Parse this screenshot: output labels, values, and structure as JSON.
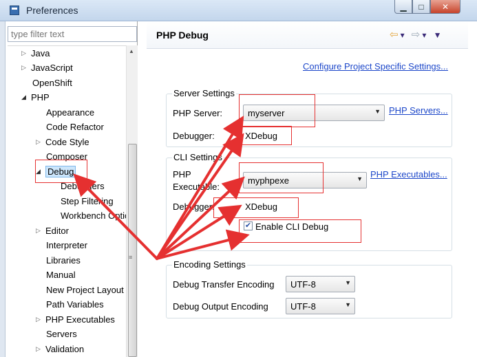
{
  "window": {
    "title": "Preferences"
  },
  "sidebar": {
    "filter_placeholder": "type filter text",
    "items": [
      {
        "label": "Java",
        "arrow": "▷"
      },
      {
        "label": "JavaScript",
        "arrow": "▷"
      },
      {
        "label": "OpenShift",
        "arrow": ""
      },
      {
        "label": "PHP",
        "arrow": "◢"
      },
      {
        "label": "Appearance",
        "arrow": ""
      },
      {
        "label": "Code Refactor",
        "arrow": ""
      },
      {
        "label": "Code Style",
        "arrow": "▷"
      },
      {
        "label": "Composer",
        "arrow": ""
      },
      {
        "label": "Debug",
        "arrow": "◢"
      },
      {
        "label": "Debuggers",
        "arrow": ""
      },
      {
        "label": "Step Filtering",
        "arrow": ""
      },
      {
        "label": "Workbench Options",
        "arrow": ""
      },
      {
        "label": "Editor",
        "arrow": "▷"
      },
      {
        "label": "Interpreter",
        "arrow": ""
      },
      {
        "label": "Libraries",
        "arrow": ""
      },
      {
        "label": "Manual",
        "arrow": ""
      },
      {
        "label": "New Project Layout",
        "arrow": ""
      },
      {
        "label": "Path Variables",
        "arrow": ""
      },
      {
        "label": "PHP Executables",
        "arrow": "▷"
      },
      {
        "label": "Servers",
        "arrow": ""
      },
      {
        "label": "Validation",
        "arrow": "▷"
      }
    ]
  },
  "page": {
    "title": "PHP Debug",
    "configure_link": "Configure Project Specific Settings...",
    "server_settings": {
      "group_label": "Server Settings",
      "php_server_label": "PHP Server:",
      "php_server_value": "myserver",
      "php_servers_link": "PHP Servers...",
      "debugger_label": "Debugger:",
      "debugger_value": "XDebug"
    },
    "cli_settings": {
      "group_label": "CLI Settings",
      "php_exe_label_1": "PHP",
      "php_exe_label_2": "Executable:",
      "php_exe_value": "myphpexe",
      "php_executables_link": "PHP Executables...",
      "debugger_label": "Debugger:",
      "debugger_value": "XDebug",
      "enable_cli_label": "Enable CLI Debug",
      "enable_cli_checked": true
    },
    "encoding_settings": {
      "group_label": "Encoding Settings",
      "transfer_label": "Debug Transfer Encoding",
      "transfer_value": "UTF-8",
      "output_label": "Debug Output Encoding",
      "output_value": "UTF-8"
    }
  },
  "annotation_color": "#e53030"
}
